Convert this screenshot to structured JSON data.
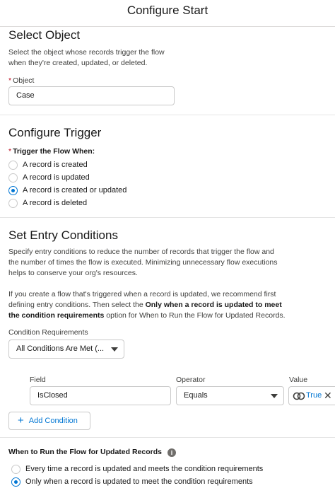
{
  "header": {
    "title": "Configure Start"
  },
  "select_object": {
    "heading": "Select Object",
    "description_1": "Select the object whose records trigger the flow",
    "description_2": "when they're created, updated, or deleted.",
    "object_label": "Object",
    "object_value": "Case"
  },
  "configure_trigger": {
    "heading": "Configure Trigger",
    "trigger_label": "Trigger the Flow When:",
    "options": [
      {
        "label": "A record is created",
        "checked": false
      },
      {
        "label": "A record is updated",
        "checked": false
      },
      {
        "label": "A record is created or updated",
        "checked": true
      },
      {
        "label": "A record is deleted",
        "checked": false
      }
    ]
  },
  "entry_conditions": {
    "heading": "Set Entry Conditions",
    "para1": [
      "Specify entry conditions to reduce the number of records that trigger the flow and",
      "the number of times the flow is executed. Minimizing unnecessary flow executions",
      "helps to conserve your org's resources."
    ],
    "para2_line1": "If you create a flow that's triggered when a record is updated, we recommend first",
    "para2_line2_pre": "defining entry conditions. Then select the ",
    "para2_line2_bold": "Only when a record is updated to meet",
    "para2_line3_bold": "the condition requirements",
    "para2_line3_post": " option for When to Run the Flow for Updated Records.",
    "requirements_label": "Condition Requirements",
    "requirements_value": "All Conditions Are Met (...",
    "field_col": "Field",
    "operator_col": "Operator",
    "value_col": "Value",
    "field_value": "IsClosed",
    "operator_value": "Equals",
    "value_value": "True",
    "add_condition": "Add Condition"
  },
  "when_to_run": {
    "heading": "When to Run the Flow for Updated Records",
    "info_icon": "i",
    "options": [
      {
        "label": "Every time a record is updated and meets the condition requirements",
        "checked": false
      },
      {
        "label": "Only when a record is updated to meet the condition requirements",
        "checked": true
      }
    ]
  },
  "colors": {
    "accent": "#0176d3",
    "required": "#ba0517"
  },
  "icons": {
    "value_type": "boolean-toggle-icon",
    "remove": "close-icon",
    "add": "plus-icon",
    "info": "info-icon",
    "dropdown": "chevron-down-icon"
  }
}
